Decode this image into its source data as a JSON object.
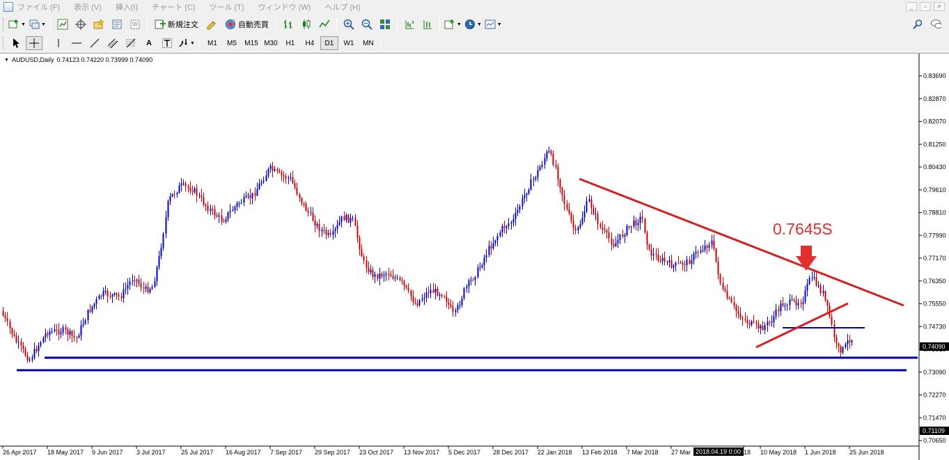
{
  "menu": {
    "items": [
      "ファイル (F)",
      "表示 (V)",
      "挿入(I)",
      "チャート (C)",
      "ツール (T)",
      "ウィンドウ (W)",
      "ヘルプ (H)"
    ],
    "window_buttons": [
      "_",
      "▫",
      "×"
    ]
  },
  "toolbar": {
    "new_order_label": "新規注文",
    "auto_trade_label": "自動売買",
    "label_tool": "A",
    "timeframes": [
      "M1",
      "M5",
      "M15",
      "M30",
      "H1",
      "H4",
      "D1",
      "W1",
      "MN"
    ],
    "active_timeframe": "D1"
  },
  "chart": {
    "symbol": "AUDUSD,Daily",
    "ohlc": "0.74123 0.74220 0.73999 0.74090",
    "annotation": "0.7645S",
    "current_price": "0.74090",
    "low_marker_price": "0.71109",
    "crosshair_time": "2018.04.19 0:00",
    "price_ticks": [
      "0.83690",
      "0.82870",
      "0.82070",
      "0.81250",
      "0.80430",
      "0.79610",
      "0.78810",
      "0.77990",
      "0.77170",
      "0.76350",
      "0.75550",
      "0.74730",
      "0.73910",
      "0.73090",
      "0.72270",
      "0.71470",
      "0.70650"
    ],
    "date_ticks": [
      "26 Apr 2017",
      "18 May 2017",
      "9 Jun 2017",
      "3 Jul 2017",
      "25 Jul 2017",
      "16 Aug 2017",
      "7 Sep 2017",
      "29 Sep 2017",
      "23 Oct 2017",
      "13 Nov 2017",
      "5 Dec 2017",
      "28 Dec 2017",
      "22 Jan 2018",
      "13 Feb 2018",
      "7 Mar 2018",
      "27 Mar",
      "18",
      "10 May 2018",
      "1 Jun 2018",
      "25 Jun 2018"
    ],
    "colors": {
      "bull": "#0000cc",
      "bear": "#cc0000",
      "trendline": "#d42020",
      "support": "#0000a8",
      "annotation": "#e03030"
    }
  }
}
